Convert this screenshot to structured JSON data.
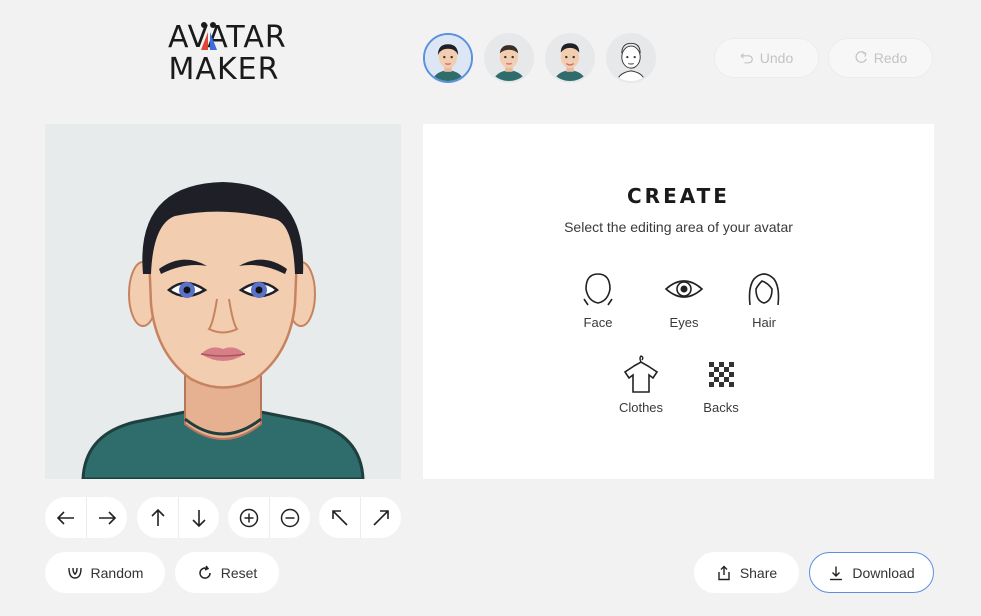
{
  "logo": {
    "line1": "AVATAR",
    "line2": "MAKER",
    "accent_red": "#e0453a",
    "accent_blue": "#3d6ee0"
  },
  "presets": [
    {
      "name": "preset-avatar-1",
      "active": true
    },
    {
      "name": "preset-avatar-2",
      "active": false
    },
    {
      "name": "preset-avatar-3",
      "active": false
    },
    {
      "name": "preset-avatar-4",
      "active": false
    }
  ],
  "toolbar": {
    "undo_label": "Undo",
    "redo_label": "Redo",
    "undo_icon": "undo-icon",
    "redo_icon": "redo-icon"
  },
  "panel": {
    "title": "CREATE",
    "subtitle": "Select the editing area of your avatar",
    "areas": [
      {
        "label": "Face",
        "icon": "face-icon"
      },
      {
        "label": "Eyes",
        "icon": "eye-icon"
      },
      {
        "label": "Hair",
        "icon": "hair-icon"
      },
      {
        "label": "Clothes",
        "icon": "shirt-icon"
      },
      {
        "label": "Backs",
        "icon": "checkerboard-icon"
      }
    ]
  },
  "controls": {
    "move": [
      "arrow-left-icon",
      "arrow-right-icon"
    ],
    "vertical": [
      "arrow-up-icon",
      "arrow-down-icon"
    ],
    "zoom": [
      "zoom-in-icon",
      "zoom-out-icon"
    ],
    "rotate": [
      "arrow-up-left-icon",
      "arrow-up-right-icon"
    ]
  },
  "actions": {
    "random_label": "Random",
    "reset_label": "Reset",
    "share_label": "Share",
    "download_label": "Download",
    "primary_color": "#5b8fe0"
  },
  "colors": {
    "background": "#f2f2f2",
    "preview_bg": "#e7ebec",
    "skin": "#f3cdb0",
    "hair": "#1f2027",
    "shirt": "#2f6d6c",
    "iris": "#5a73c9",
    "lips": "#d77f86"
  }
}
